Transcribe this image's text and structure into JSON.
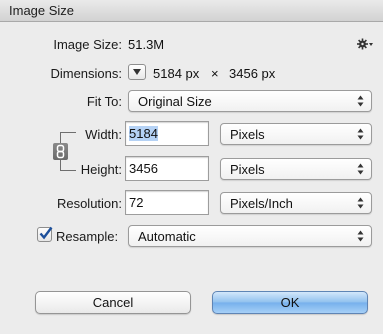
{
  "window": {
    "title": "Image Size"
  },
  "image_size": {
    "label": "Image Size:",
    "value": "51.3M"
  },
  "dimensions": {
    "label": "Dimensions:",
    "width": "5184 px",
    "times": "×",
    "height": "3456 px"
  },
  "fit_to": {
    "label": "Fit To:",
    "value": "Original Size"
  },
  "width": {
    "label": "Width:",
    "value": "5184",
    "unit": "Pixels"
  },
  "height": {
    "label": "Height:",
    "value": "3456",
    "unit": "Pixels"
  },
  "resolution": {
    "label": "Resolution:",
    "value": "72",
    "unit": "Pixels/Inch"
  },
  "resample": {
    "label": "Resample:",
    "checked": true,
    "value": "Automatic"
  },
  "buttons": {
    "cancel": "Cancel",
    "ok": "OK"
  },
  "icons": {
    "settings": "gear-icon",
    "link": "chain-link-icon",
    "dimensions_menu": "dropdown-triangle-icon"
  },
  "colors": {
    "selection": "#b5d2f5",
    "default_button": "#8fc0ee",
    "checkbox_check": "#1c4f9b"
  }
}
